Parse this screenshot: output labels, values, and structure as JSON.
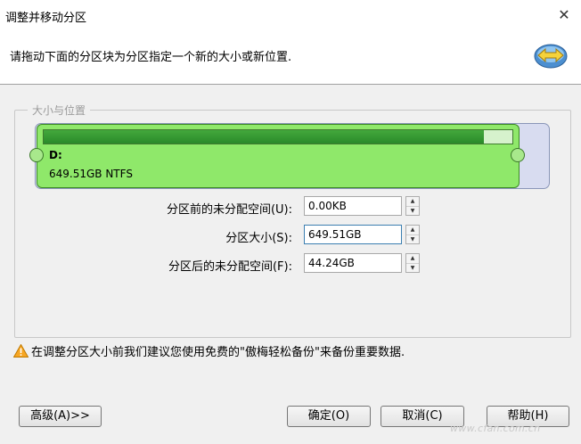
{
  "window": {
    "title": "调整并移动分区",
    "close_icon": "close-icon"
  },
  "header": {
    "instruction": "请拖动下面的分区块为分区指定一个新的大小或新位置.",
    "icon": "resize-arrows-icon"
  },
  "group": {
    "label": "大小与位置"
  },
  "partition": {
    "name": "D:",
    "info": "649.51GB NTFS",
    "used_fraction": 0.94,
    "color": "#8fe86a"
  },
  "fields": [
    {
      "label": "分区前的未分配空间(U):",
      "value": "0.00KB"
    },
    {
      "label": "分区大小(S):",
      "value": "649.51GB"
    },
    {
      "label": "分区后的未分配空间(F):",
      "value": "44.24GB"
    }
  ],
  "warning": {
    "text": "在调整分区大小前我们建议您使用免费的\"傲梅轻松备份\"来备份重要数据.",
    "icon": "warning-icon"
  },
  "buttons": {
    "advanced": "高级(A)>>",
    "ok": "确定(O)",
    "cancel": "取消(C)",
    "help": "帮助(H)"
  },
  "watermark": "www.cfan.com.cn"
}
